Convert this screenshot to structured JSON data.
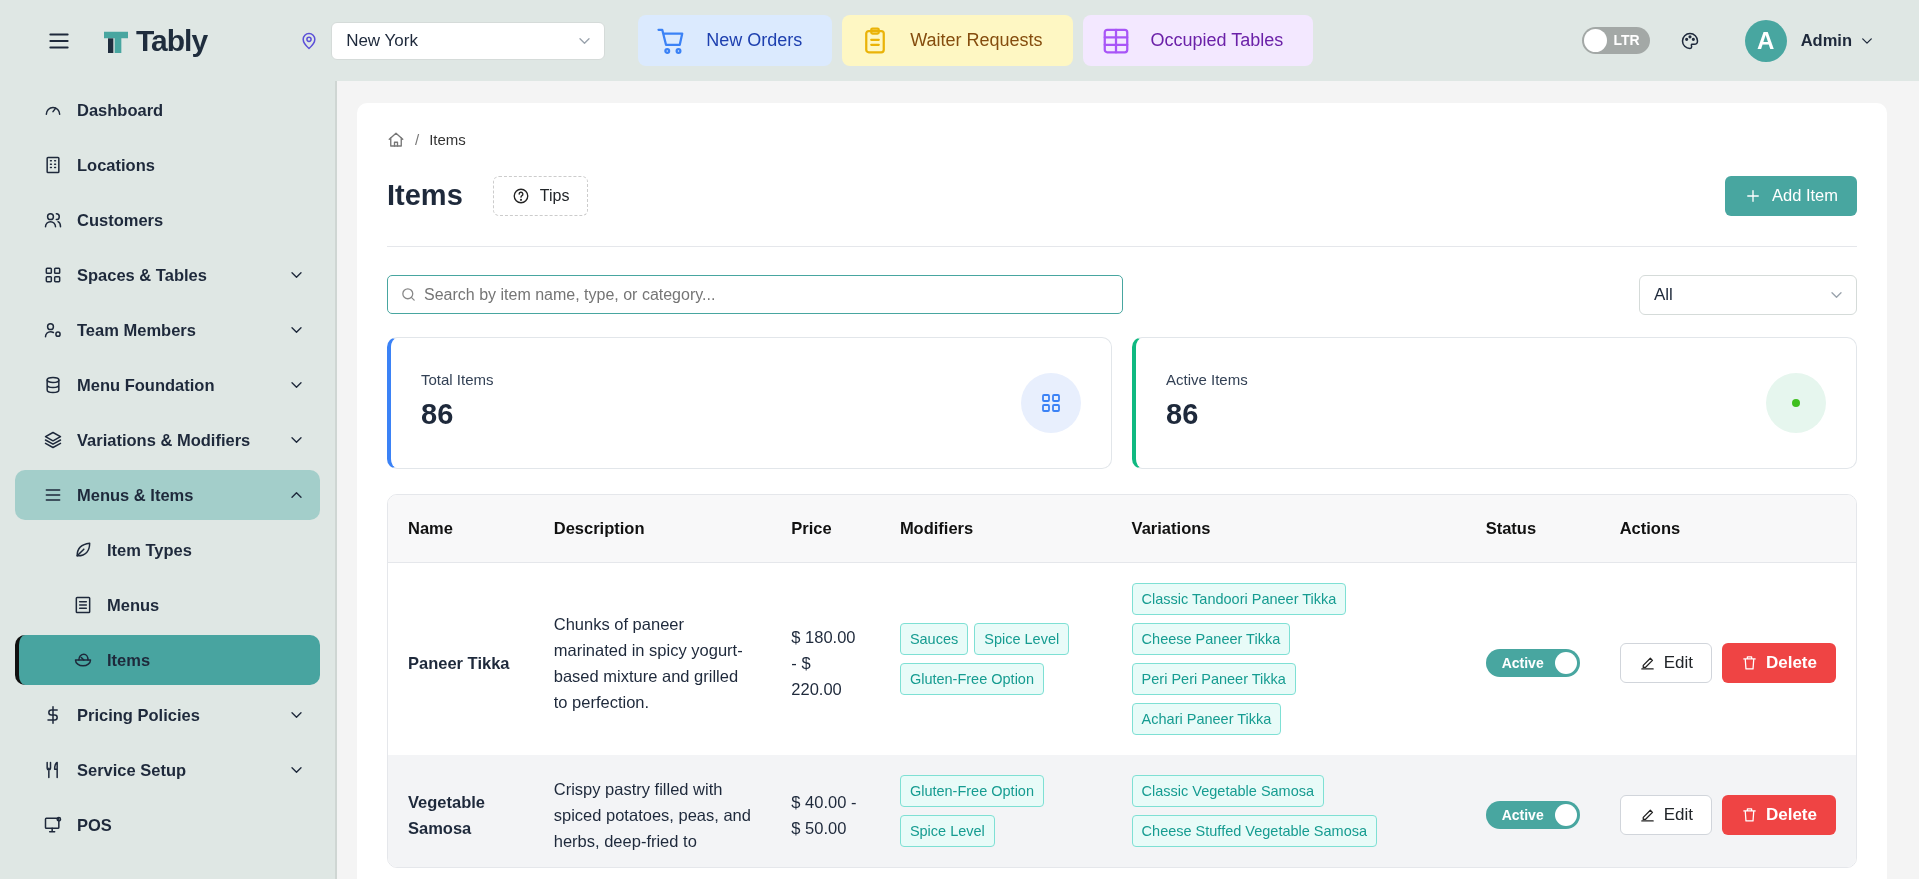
{
  "header": {
    "logo_text": "Tably",
    "location": {
      "value": "New York"
    },
    "quick_links": [
      {
        "label": "New Orders",
        "kind": "orders"
      },
      {
        "label": "Waiter Requests",
        "kind": "requests"
      },
      {
        "label": "Occupied Tables",
        "kind": "tables"
      }
    ],
    "direction_toggle": {
      "label": "LTR",
      "on": false
    },
    "user": {
      "initial": "A",
      "name": "Admin"
    }
  },
  "sidebar": {
    "items": [
      {
        "label": "Dashboard",
        "kind": "link",
        "selected": false
      },
      {
        "label": "Locations",
        "kind": "link",
        "selected": false
      },
      {
        "label": "Customers",
        "kind": "link",
        "selected": false
      },
      {
        "label": "Spaces & Tables",
        "kind": "group",
        "expanded": false,
        "selected": false
      },
      {
        "label": "Team Members",
        "kind": "group",
        "expanded": false,
        "selected": false
      },
      {
        "label": "Menu Foundation",
        "kind": "group",
        "expanded": false,
        "selected": false
      },
      {
        "label": "Variations & Modifiers",
        "kind": "group",
        "expanded": false,
        "selected": false
      },
      {
        "label": "Menus & Items",
        "kind": "group",
        "expanded": true,
        "selected": true,
        "children": [
          {
            "label": "Item Types",
            "selected": false
          },
          {
            "label": "Menus",
            "selected": false
          },
          {
            "label": "Items",
            "selected": true
          }
        ]
      },
      {
        "label": "Pricing Policies",
        "kind": "group",
        "expanded": false,
        "selected": false
      },
      {
        "label": "Service Setup",
        "kind": "group",
        "expanded": false,
        "selected": false
      },
      {
        "label": "POS",
        "kind": "link",
        "selected": false
      }
    ]
  },
  "page": {
    "breadcrumb": {
      "separator": "/",
      "items": [
        "Items"
      ]
    },
    "title": "Items",
    "tips_button": "Tips",
    "add_button": "Add Item",
    "search": {
      "placeholder": "Search by item name, type, or category..."
    },
    "filter": {
      "value": "All"
    },
    "stats": [
      {
        "label": "Total Items",
        "value": "86",
        "color": "#3b82f6",
        "kind": "grid"
      },
      {
        "label": "Active Items",
        "value": "86",
        "color": "#10b981",
        "kind": "dot"
      }
    ],
    "table": {
      "columns": [
        "Name",
        "Description",
        "Price",
        "Modifiers",
        "Variations",
        "Status",
        "Actions"
      ],
      "rows": [
        {
          "name": "Paneer Tikka",
          "description": "Chunks of paneer marinated in spicy yogurt-based mixture and grilled to perfection.",
          "price": "$ 180.00 - $ 220.00",
          "modifiers": [
            "Sauces",
            "Spice Level",
            "Gluten-Free Option"
          ],
          "variations": [
            "Classic Tandoori Paneer Tikka",
            "Cheese Paneer Tikka",
            "Peri Peri Paneer Tikka",
            "Achari Paneer Tikka"
          ],
          "status": {
            "label": "Active",
            "on": true
          },
          "edit": "Edit",
          "delete": "Delete"
        },
        {
          "name": "Vegetable Samosa",
          "description": "Crispy pastry filled with spiced potatoes, peas, and herbs, deep-fried to",
          "price": "$ 40.00 - $ 50.00",
          "modifiers": [
            "Gluten-Free Option",
            "Spice Level"
          ],
          "variations": [
            "Classic Vegetable Samosa",
            "Cheese Stuffed Vegetable Samosa"
          ],
          "status": {
            "label": "Active",
            "on": true
          },
          "edit": "Edit",
          "delete": "Delete"
        }
      ]
    }
  }
}
